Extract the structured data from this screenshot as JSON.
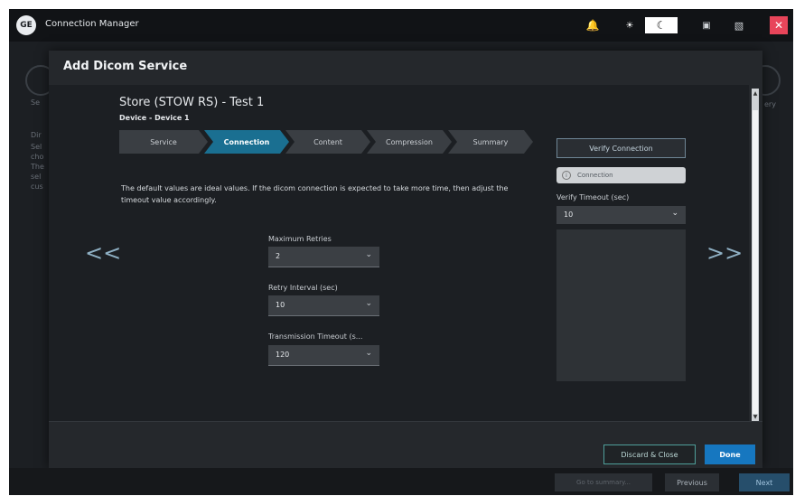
{
  "titlebar": {
    "logo_text": "GE",
    "app_title": "Connection Manager",
    "icons": [
      "bell-icon",
      "sun-icon",
      "moon-icon",
      "monitor-icon",
      "user-icon",
      "close-icon"
    ]
  },
  "modal": {
    "title": "Add Dicom Service",
    "service_name": "Store (STOW RS) - Test 1",
    "device_name": "Device - Device 1",
    "steps": [
      "Service",
      "Connection",
      "Content",
      "Compression",
      "Summary"
    ],
    "active_step": "Connection",
    "info_text": "The default values are ideal values. If the dicom connection is expected to take more time, then adjust the timeout value accordingly.",
    "fields": [
      {
        "label": "Maximum Retries",
        "value": "2"
      },
      {
        "label": "Retry Interval (sec)",
        "value": "10"
      },
      {
        "label": "Transmission Timeout (s...",
        "value": "120"
      }
    ],
    "verify": {
      "button_label": "Verify Connection",
      "status_label": "Connection",
      "timeout_label": "Verify Timeout (sec)",
      "timeout_value": "10"
    },
    "nav": {
      "prev_glyph": "<<",
      "next_glyph": ">>"
    },
    "footer": {
      "discard_label": "Discard & Close",
      "done_label": "Done"
    }
  },
  "background": {
    "left_fragments": [
      "Se",
      "Dir",
      "Sel",
      "cho",
      "The",
      "sel",
      "cus"
    ],
    "right_fragment": "ery"
  },
  "bottombar": {
    "field_text": "Go to summary...",
    "previous_label": "Previous",
    "next_label": "Next"
  },
  "colors": {
    "accent": "#1a6f91",
    "done": "#1677c0",
    "close": "#e8455a",
    "discard_border": "#4f9f9a"
  }
}
